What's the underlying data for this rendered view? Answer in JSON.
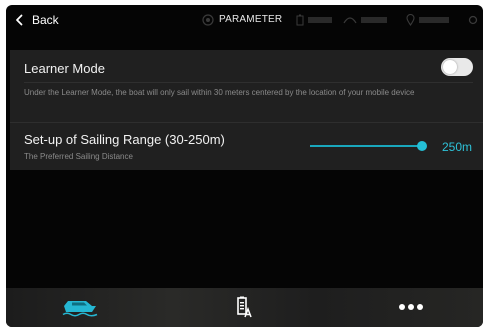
{
  "topbar": {
    "back_label": "Back",
    "title": "PARAMETER"
  },
  "settings": {
    "learner_mode": {
      "title": "Learner Mode",
      "description": "Under the Learner Mode, the boat will only sail within 30 meters centered by the location of your mobile device",
      "enabled": false
    },
    "sailing_range": {
      "title": "Set-up of Sailing Range (30-250m)",
      "subtitle": "The Preferred Sailing Distance",
      "value_label": "250m",
      "value": 250,
      "min": 30,
      "max": 250
    }
  },
  "bottom_nav": {
    "items": [
      "boat-icon",
      "battery-doc-icon",
      "more-icon"
    ]
  },
  "colors": {
    "accent": "#24bfd6",
    "background": "#050505",
    "card": "#202020"
  }
}
